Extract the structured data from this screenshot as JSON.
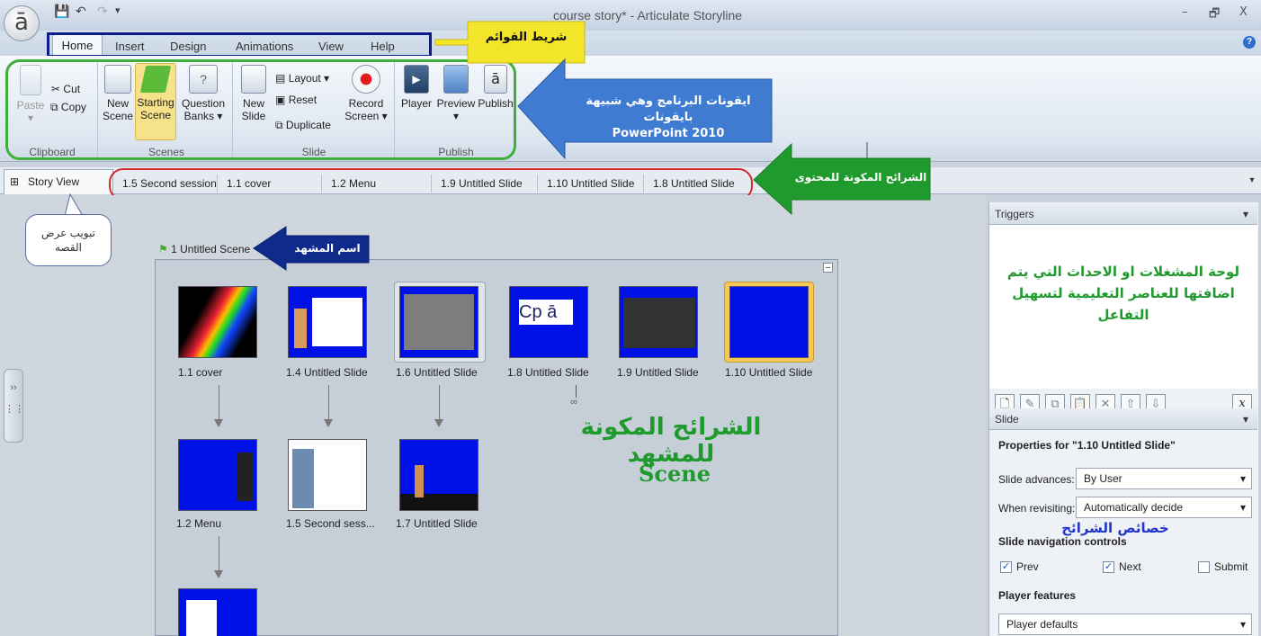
{
  "window": {
    "title": "course story* - Articulate Storyline",
    "minimize": "–",
    "restore": "🗗",
    "close": "X"
  },
  "menu": {
    "tabs": [
      "Home",
      "Insert",
      "Design",
      "Animations",
      "View",
      "Help"
    ]
  },
  "ribbon": {
    "clipboard": {
      "paste": "Paste",
      "cut": "Cut",
      "copy": "Copy",
      "label": "Clipboard"
    },
    "scenes": {
      "new_scene": [
        "New",
        "Scene"
      ],
      "starting_scene": [
        "Starting",
        "Scene"
      ],
      "question_banks": [
        "Question",
        "Banks"
      ],
      "label": "Scenes"
    },
    "slide": {
      "new_slide": [
        "New",
        "Slide"
      ],
      "layout": "Layout",
      "reset": "Reset",
      "duplicate": "Duplicate",
      "record_screen": [
        "Record",
        "Screen"
      ],
      "label": "Slide"
    },
    "publish": {
      "player": "Player",
      "preview": "Preview",
      "publish": "Publish",
      "label": "Publish"
    }
  },
  "slide_tabs": {
    "story_view": "Story View",
    "tabs": [
      "1.5 Second session",
      "1.1 cover",
      "1.2 Menu",
      "1.9 Untitled Slide",
      "1.10 Untitled Slide",
      "1.8 Untitled Slide"
    ]
  },
  "scene": {
    "title": "1 Untitled Scene",
    "slides_row1": [
      "1.1 cover",
      "1.4 Untitled Slide",
      "1.6 Untitled Slide",
      "1.8 Untitled Slide",
      "1.9 Untitled Slide",
      "1.10 Untitled Slide"
    ],
    "slides_row2": [
      "1.2 Menu",
      "1.5 Second sess...",
      "1.7 Untitled Slide"
    ]
  },
  "triggers_panel": {
    "title": "Triggers",
    "buttons": [
      "new-trigger",
      "edit",
      "copy",
      "paste",
      "delete",
      "move-up",
      "move-down"
    ],
    "variables_button": "x"
  },
  "slide_panel": {
    "title": "Slide",
    "properties_for": "Properties for \"1.10 Untitled Slide\"",
    "slide_advances_label": "Slide advances:",
    "slide_advances_value": "By User",
    "when_revisiting_label": "When revisiting:",
    "when_revisiting_value": "Automatically decide",
    "nav_controls_label": "Slide navigation controls",
    "prev": "Prev",
    "next": "Next",
    "submit": "Submit",
    "prev_checked": true,
    "next_checked": true,
    "submit_checked": false,
    "player_features_label": "Player features",
    "player_defaults": "Player defaults"
  },
  "annotations": {
    "menu_bar": "شريط القوائم",
    "icons": [
      "ايقونات البرنامج وهي شبيهة بايقونات",
      "PowerPoint 2010"
    ],
    "content_slides": "الشرائح المكونة للمحتوى",
    "story_view_tab": [
      "تبويب عرض",
      "القصه"
    ],
    "scene_name": "اسم المشهد",
    "triggers_desc": [
      "لوحة المشغلات او الاحداث التي يتم",
      "اضافتها للعناصر التعليمية لتسهيل",
      "التفاعل"
    ],
    "scene_slides": "الشرائح المكونة للمشهد",
    "scene_word": "Scene",
    "slide_props": "خصائص الشرائح"
  },
  "colors": {
    "slide_blue": "#0011e8",
    "annotation_green": "#1f9a2d",
    "annotation_blue": "#3e7bd1",
    "annotation_navy": "#0e2a8a",
    "annotation_yellow": "#f2e52a"
  }
}
